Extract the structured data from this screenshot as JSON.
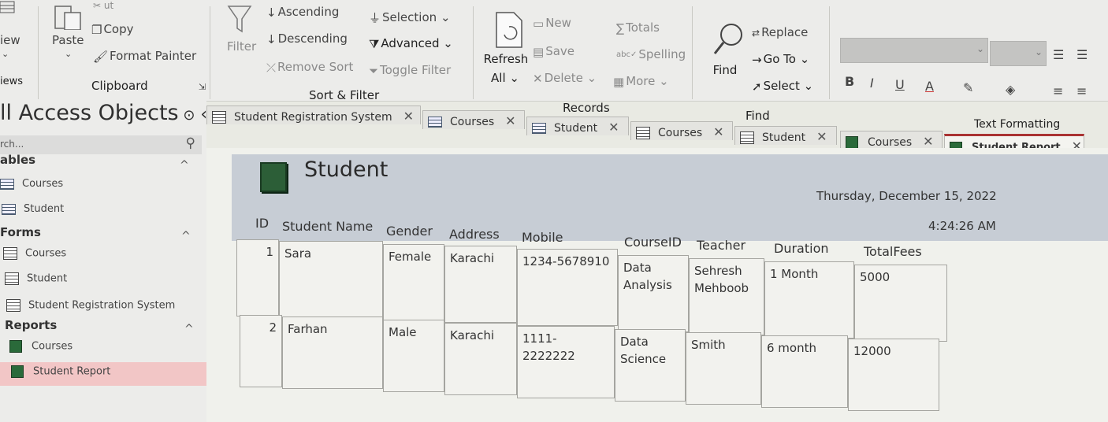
{
  "ribbon": {
    "view_label": "iew",
    "views_group": "iews",
    "cut_label": "ut",
    "paste_label": "Paste",
    "copy_label": "Copy",
    "format_painter_label": "Format Painter",
    "clipboard_group": "Clipboard",
    "filter_label": "Filter",
    "ascending_label": "Ascending",
    "descending_label": "Descending",
    "remove_sort_label": "Remove Sort",
    "selection_label": "Selection",
    "advanced_label": "Advanced",
    "toggle_filter_label": "Toggle Filter",
    "sort_filter_group": "Sort & Filter",
    "refresh_label": "Refresh",
    "refresh_all_label": "All",
    "new_label": "New",
    "save_label": "Save",
    "delete_label": "Delete",
    "totals_label": "Totals",
    "spelling_label": "Spelling",
    "more_label": "More",
    "records_group": "Records",
    "find_label": "Find",
    "replace_label": "Replace",
    "goto_label": "Go To",
    "select_label": "Select",
    "find_group": "Find",
    "bold_label": "B",
    "italic_label": "I",
    "underline_label": "U",
    "font_color_label": "A",
    "text_formatting_group": "Text Formatting"
  },
  "nav": {
    "title": "ll Access Objects",
    "search_placeholder": "rch...",
    "tables_header": "ables",
    "tables": [
      "Courses",
      "Student"
    ],
    "forms_header": "Forms",
    "forms": [
      "Courses",
      "Student",
      "Student Registration System"
    ],
    "reports_header": "Reports",
    "reports": [
      "Courses",
      "Student Report"
    ]
  },
  "tabs": [
    {
      "label": "Student Registration System",
      "type": "form-icon"
    },
    {
      "label": "Courses",
      "type": "table-icon"
    },
    {
      "label": "Student",
      "type": "table-icon"
    },
    {
      "label": "Courses",
      "type": "form-icon"
    },
    {
      "label": "Student",
      "type": "form-icon"
    },
    {
      "label": "Courses",
      "type": "report-icon"
    },
    {
      "label": "Student Report",
      "type": "report-icon",
      "active": true
    }
  ],
  "report": {
    "title": "Student",
    "date": "Thursday, December 15, 2022",
    "time": "4:24:26 AM",
    "columns": [
      "ID",
      "Student Name",
      "Gender",
      "Address",
      "Mobile",
      "CourseID",
      "Teacher",
      "Duration",
      "TotalFees"
    ],
    "rows": [
      {
        "id": "1",
        "name": "Sara",
        "gender": "Female",
        "address": "Karachi",
        "mobile": "1234-5678910",
        "course": "Data Analysis",
        "teacher": "Sehresh Mehboob",
        "duration": "1 Month",
        "fees": "5000"
      },
      {
        "id": "2",
        "name": "Farhan",
        "gender": "Male",
        "address": "Karachi",
        "mobile": "1111-2222222",
        "course": "Data Science",
        "teacher": "Smith",
        "duration": "6 month",
        "fees": "12000"
      }
    ]
  },
  "colors": {
    "ribbon": "#ececea",
    "report_header": "#c7cdd5",
    "active_tab_accent": "#aa3333",
    "selected_nav": "#f2c6c6"
  }
}
